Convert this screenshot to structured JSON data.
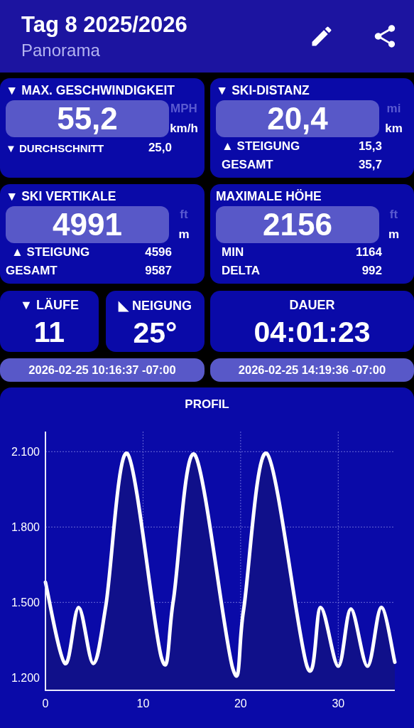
{
  "header": {
    "title": "Tag 8 2025/2026",
    "subtitle": "Panorama"
  },
  "stat_cards": [
    {
      "title": "▼ MAX. GESCHWINDIGKEIT",
      "value": "55,2",
      "units": [
        {
          "label": "MPH",
          "selected": false
        },
        {
          "label": "km/h",
          "selected": true
        }
      ],
      "rows": [
        {
          "label": "▼ DURCHSCHNITT",
          "value": "25,0",
          "kind": "small"
        }
      ]
    },
    {
      "title": "▼ SKI-DISTANZ",
      "value": "20,4",
      "units": [
        {
          "label": "mi",
          "selected": false
        },
        {
          "label": "km",
          "selected": true
        }
      ],
      "rows": [
        {
          "label": "▲ STEIGUNG",
          "value": "15,3",
          "kind": "indented"
        },
        {
          "label": "GESAMT",
          "value": "35,7",
          "kind": "indented"
        }
      ]
    },
    {
      "title": "▼ SKI VERTIKALE",
      "value": "4991",
      "units": [
        {
          "label": "ft",
          "selected": false
        },
        {
          "label": "m",
          "selected": true
        }
      ],
      "rows": [
        {
          "label": "▲ STEIGUNG",
          "value": "4596",
          "kind": "indented"
        },
        {
          "label": "GESAMT",
          "value": "9587",
          "kind": "plain"
        }
      ]
    },
    {
      "title": "MAXIMALE HÖHE",
      "value": "2156",
      "units": [
        {
          "label": "ft",
          "selected": false
        },
        {
          "label": "m",
          "selected": true
        }
      ],
      "rows": [
        {
          "label": "MIN",
          "value": "1164",
          "kind": "indented"
        },
        {
          "label": "DELTA",
          "value": "992",
          "kind": "indented"
        }
      ]
    }
  ],
  "counters": [
    {
      "kind": "small",
      "title": "▼ LÄUFE",
      "value": "11"
    },
    {
      "kind": "small",
      "title": "◣ NEIGUNG",
      "value": "25°"
    },
    {
      "kind": "wide",
      "title": "DAUER",
      "value": "04:01:23"
    }
  ],
  "timestamps": [
    "2026-02-25 10:16:37 -07:00",
    "2026-02-25 14:19:36 -07:00"
  ],
  "profile": {
    "title": "PROFIL",
    "chart_data": {
      "type": "area",
      "xlim": [
        0,
        35.8
      ],
      "ylim": [
        1150,
        2180
      ],
      "xticks": [
        0,
        10,
        20,
        30
      ],
      "yticks": [
        {
          "value": 1200,
          "label": "1.200"
        },
        {
          "value": 1500,
          "label": "1.500"
        },
        {
          "value": 1800,
          "label": "1.800"
        },
        {
          "value": 2100,
          "label": "2.100"
        }
      ],
      "x": [
        0,
        2.0,
        3.4,
        4.9,
        6.2,
        8.4,
        11.9,
        13.1,
        15.3,
        19.2,
        20.3,
        22.7,
        26.8,
        28.2,
        30.0,
        31.3,
        33.0,
        34.4,
        35.8
      ],
      "grid": true,
      "series": [
        {
          "color": "#ffffff",
          "values": [
            1580,
            1257,
            1480,
            1257,
            1490,
            2092,
            1278,
            1506,
            2088,
            1236,
            1469,
            2092,
            1246,
            1480,
            1246,
            1474,
            1246,
            1480,
            1262
          ]
        }
      ]
    }
  }
}
